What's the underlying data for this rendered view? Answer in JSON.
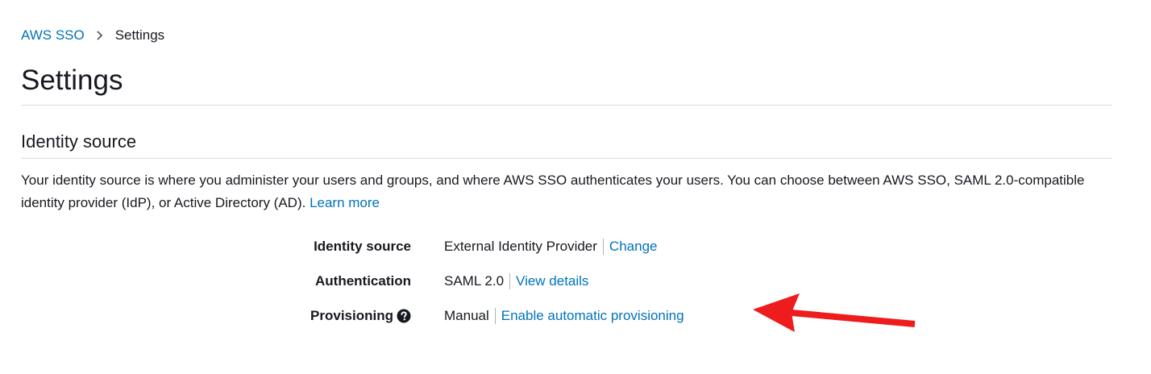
{
  "breadcrumb": {
    "root": "AWS SSO",
    "current": "Settings"
  },
  "page": {
    "title": "Settings"
  },
  "identity_source_section": {
    "title": "Identity source",
    "description": "Your identity source is where you administer your users and groups, and where AWS SSO authenticates your users. You can choose between AWS SSO, SAML 2.0-compatible identity provider (IdP), or Active Directory (AD).",
    "learn_more": "Learn more",
    "rows": [
      {
        "label": "Identity source",
        "value": "External Identity Provider",
        "action": "Change"
      },
      {
        "label": "Authentication",
        "value": "SAML 2.0",
        "action": "View details"
      },
      {
        "label": "Provisioning",
        "value": "Manual",
        "action": "Enable automatic provisioning"
      }
    ]
  },
  "icons": {
    "help": "question-circle-icon",
    "breadcrumb_separator": "chevron-right-icon",
    "annotation": "red-arrow-icon"
  },
  "colors": {
    "link": "#0073bb",
    "text": "#16191f",
    "divider": "#d5dbdb",
    "annotation_arrow": "#ee1c1c"
  }
}
